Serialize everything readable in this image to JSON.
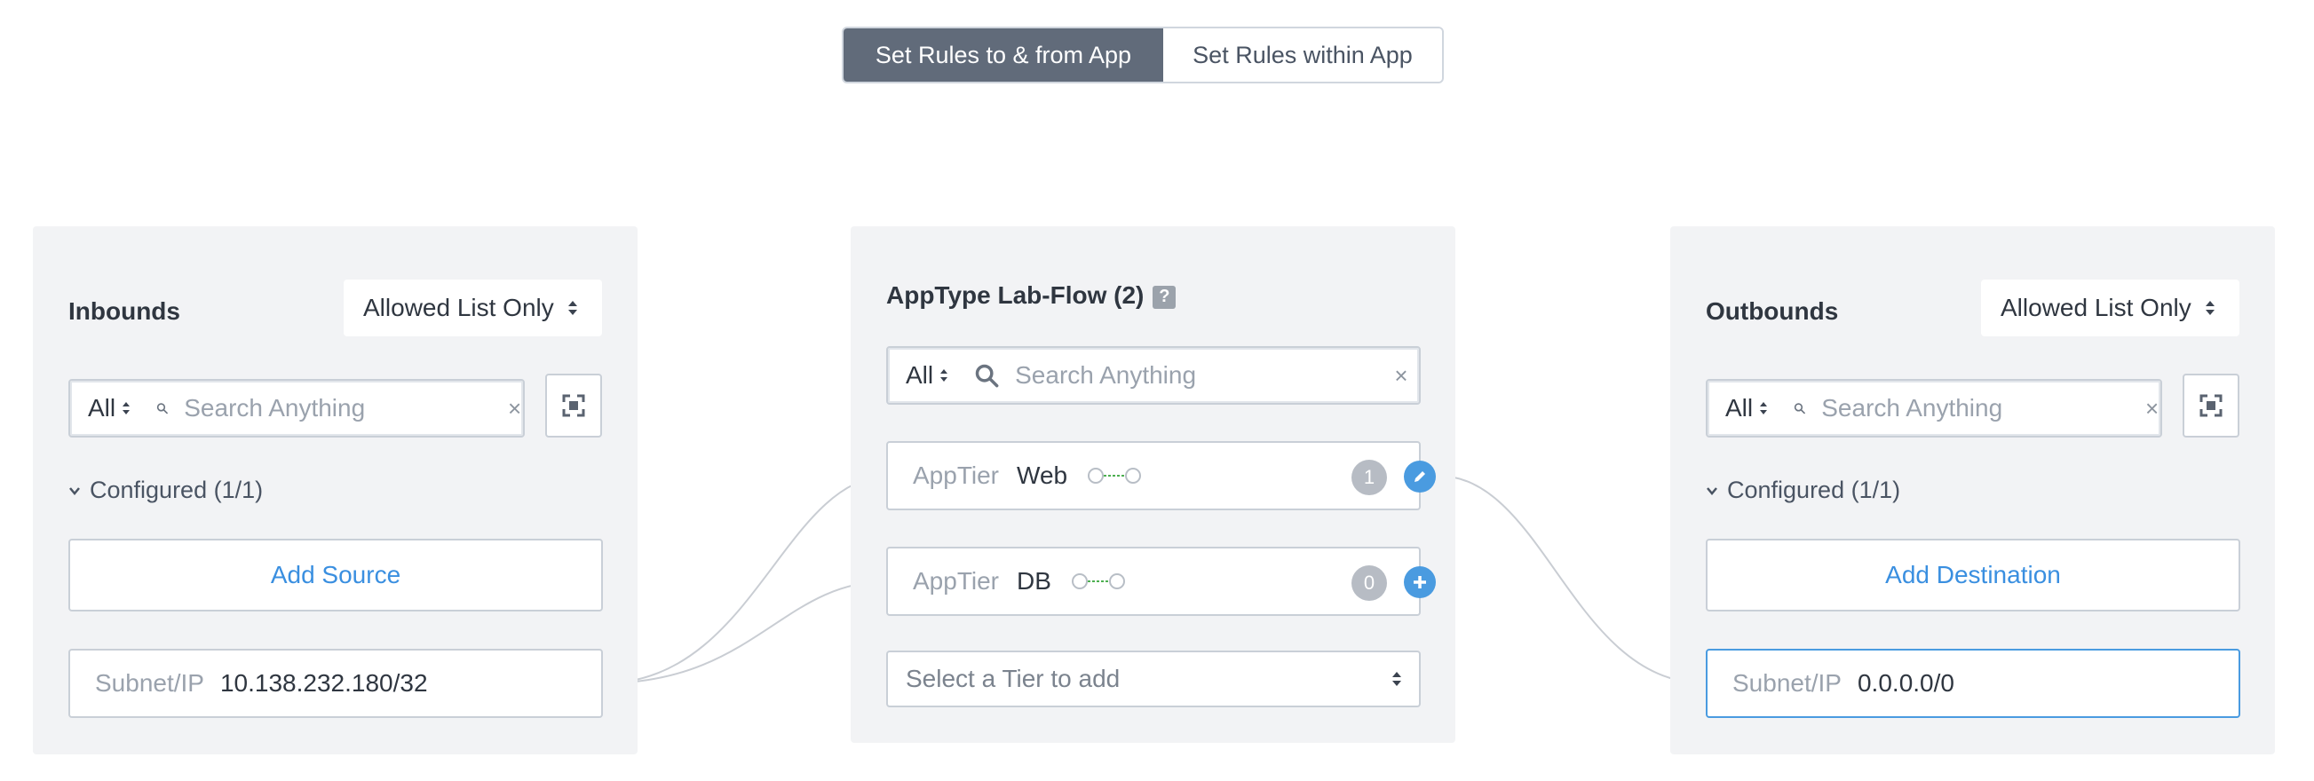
{
  "toggle": {
    "active_label": "Set Rules to & from App",
    "inactive_label": "Set Rules within App"
  },
  "inbounds": {
    "title": "Inbounds",
    "policy": "Allowed List Only",
    "search": {
      "scope": "All",
      "placeholder": "Search Anything",
      "clear": "×"
    },
    "configured": "Configured (1/1)",
    "add_label": "Add Source",
    "entry": {
      "label": "Subnet/IP",
      "value": "10.138.232.180/32"
    }
  },
  "app": {
    "title": "AppType Lab-Flow (2)",
    "help": "?",
    "search": {
      "scope": "All",
      "placeholder": "Search Anything",
      "clear": "×"
    },
    "tiers": [
      {
        "label": "AppTier",
        "name": "Web",
        "count": "1",
        "action": "edit-icon"
      },
      {
        "label": "AppTier",
        "name": "DB",
        "count": "0",
        "action": "plus-icon"
      }
    ],
    "select_tier": "Select a Tier to add"
  },
  "outbounds": {
    "title": "Outbounds",
    "policy": "Allowed List Only",
    "search": {
      "scope": "All",
      "placeholder": "Search Anything",
      "clear": "×"
    },
    "configured": "Configured (1/1)",
    "add_label": "Add Destination",
    "entry": {
      "label": "Subnet/IP",
      "value": "0.0.0.0/0"
    }
  },
  "colors": {
    "accent": "#4a9be0",
    "active_toggle": "#616b7a",
    "panel_bg": "#f2f3f5",
    "link": "#3a8fe0"
  }
}
